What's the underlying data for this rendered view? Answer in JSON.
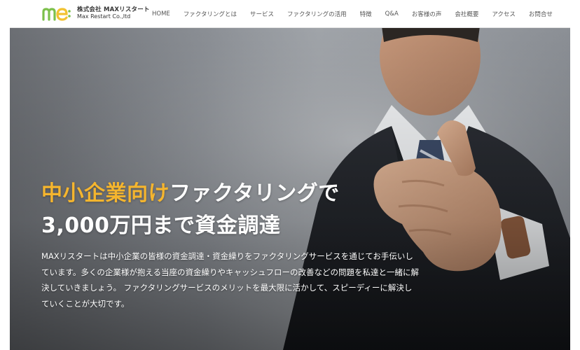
{
  "header": {
    "logo_ja": "株式会社 MAXリスタート",
    "logo_en": "Max Restart Co.,ltd",
    "nav": [
      "HOME",
      "ファクタリングとは",
      "サービス",
      "ファクタリングの活用",
      "特徴",
      "Q&A",
      "お客様の声",
      "会社概要",
      "アクセス",
      "お問合せ"
    ]
  },
  "hero": {
    "headline_accent": "中小企業向け",
    "headline_rest": "ファクタリングで",
    "headline_line2": "3,000万円まで資金調達",
    "description": "MAXリスタートは中小企業の皆様の資金調達・資金繰りをファクタリングサービスを通じてお手伝いしています。多くの企業様が抱える当座の資金繰りやキャッシュフローの改善などの問題を私達と一緒に解決していきましょう。 ファクタリングサービスのメリットを最大限に活かして、スピーディーに解決していくことが大切です。"
  },
  "colors": {
    "accent": "#f5b52e",
    "logo_green": "#7cc04b",
    "logo_yellow": "#f2c231"
  }
}
